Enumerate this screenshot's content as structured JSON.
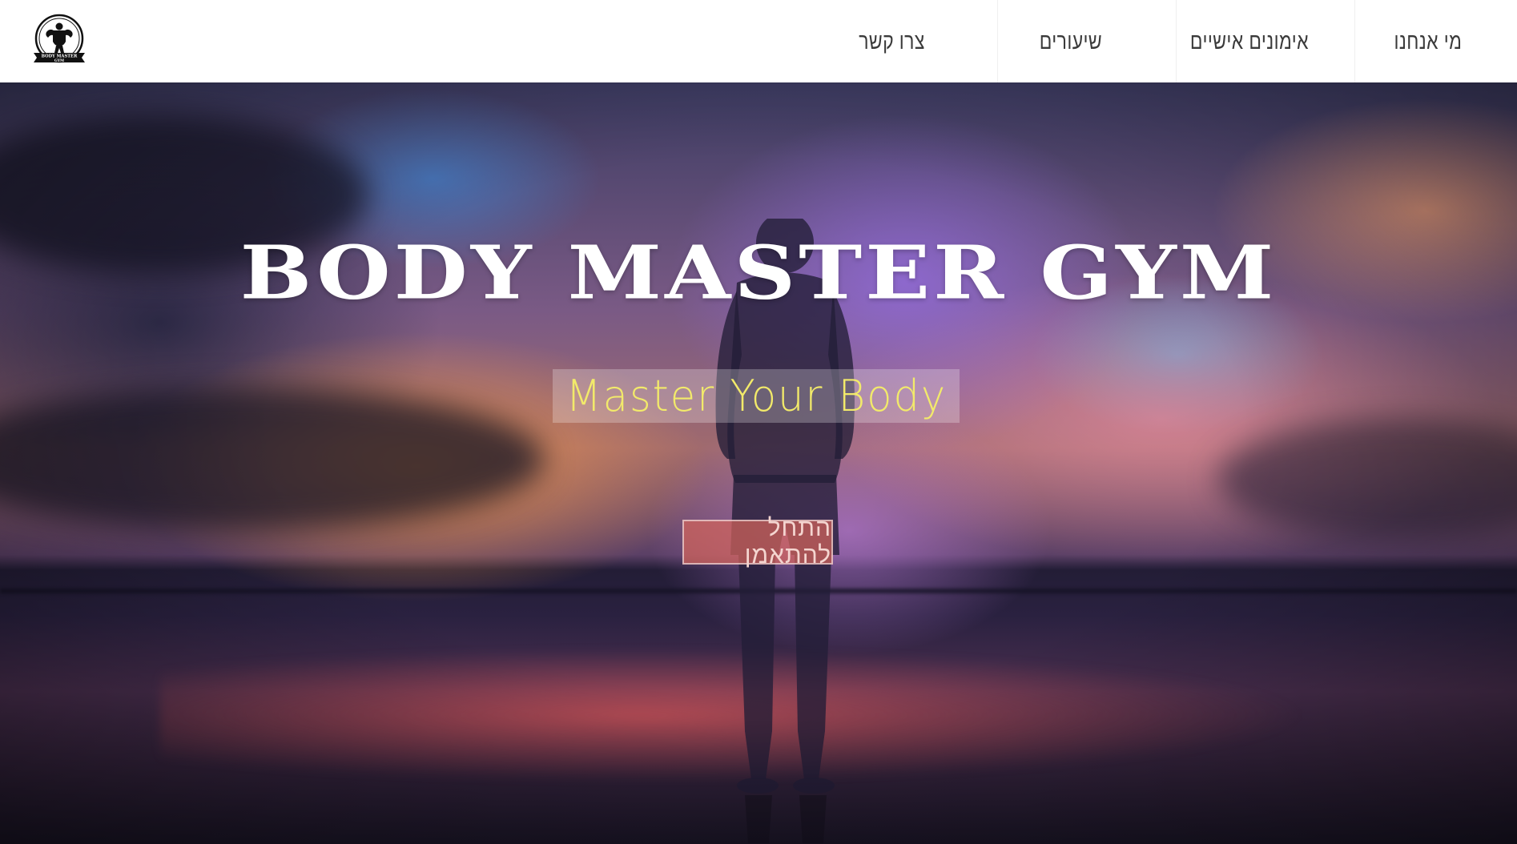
{
  "header": {
    "logo": {
      "icon": "bodybuilder-logo-icon",
      "text_top": "BODY MASTER",
      "text_bottom": "GYM"
    },
    "nav": [
      {
        "label": "מי אנחנו"
      },
      {
        "label": "אימונים אישיים"
      },
      {
        "label": "שיעורים"
      },
      {
        "label": "צרו קשר"
      }
    ]
  },
  "hero": {
    "title": "BODY MASTER GYM",
    "tagline": "Master Your Body",
    "cta_label": "התחל להתאמן",
    "colors": {
      "title": "#ffffff",
      "tagline": "#f2ea6a",
      "cta_bg": "#d2645a"
    }
  }
}
